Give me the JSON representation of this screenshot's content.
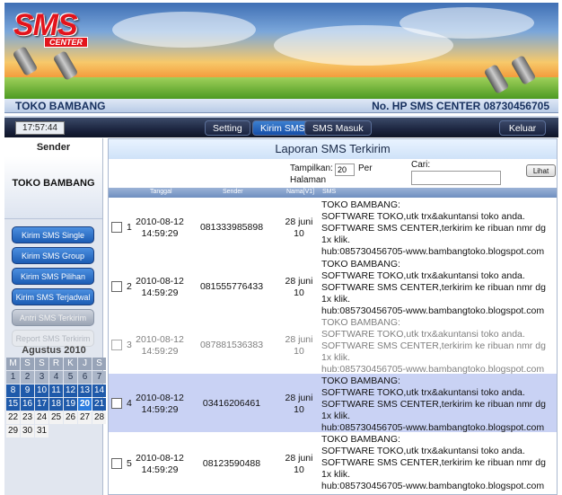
{
  "brand": {
    "logo_text": "SMS",
    "logo_sub": "CENTER"
  },
  "info_bar": {
    "shop_name": "TOKO BAMBANG",
    "hp_label": "No. HP SMS CENTER 08730456705"
  },
  "nav": {
    "clock": "17:57:44",
    "items": [
      "Setting",
      "Kirim SMS",
      "SMS Masuk",
      "Keluar"
    ],
    "active": "Kirim SMS"
  },
  "sidebar": {
    "header": "Sender",
    "shop_name": "TOKO BAMBANG",
    "menu": [
      "Kirim SMS Single",
      "Kirim SMS Group",
      "Kirim SMS Pilihan",
      "Kirim SMS Terjadwal",
      "Antri SMS Terkirim",
      "Report SMS Terkirim"
    ]
  },
  "calendar": {
    "month": "Agustus 2010",
    "weekdays": [
      "M",
      "S",
      "S",
      "R",
      "K",
      "J",
      "S"
    ],
    "prev_days": [
      1,
      2,
      3,
      4,
      5,
      6,
      7
    ],
    "days": [
      8,
      9,
      10,
      11,
      12,
      13,
      14,
      15,
      16,
      17,
      18,
      19,
      20,
      21,
      22,
      23,
      24,
      25,
      26,
      27,
      28,
      29,
      30,
      31
    ],
    "today": 20
  },
  "main": {
    "title": "Laporan SMS Terkirim",
    "show_label": "Tampilkan:",
    "show_value": "20",
    "per_label": "Per",
    "page_label": "Halaman",
    "search_label": "Cari:",
    "search_value": "",
    "view_button": "Lihat",
    "columns": [
      "Tanggal",
      "Sender",
      "Nama[V1]",
      "SMS"
    ],
    "rows": [
      {
        "no": "1",
        "date": "2010-08-12",
        "time": "14:59:29",
        "sender": "081333985898",
        "name": "28 juni",
        "name2": "10",
        "sms": "TOKO BAMBANG:\nSOFTWARE TOKO,utk trx&akuntansi toko anda.\nSOFTWARE SMS CENTER,terkirim ke ribuan nmr dg 1x klik.\nhub:085730456705-www.bambangtoko.blogspot.com"
      },
      {
        "no": "2",
        "date": "2010-08-12",
        "time": "14:59:29",
        "sender": "081555776433",
        "name": "28 juni",
        "name2": "10",
        "sms": "TOKO BAMBANG:\nSOFTWARE TOKO,utk trx&akuntansi toko anda.\nSOFTWARE SMS CENTER,terkirim ke ribuan nmr dg 1x klik.\nhub:085730456705-www.bambangtoko.blogspot.com"
      },
      {
        "no": "3",
        "date": "2010-08-12",
        "time": "14:59:29",
        "sender": "087881536383",
        "name": "28 juni",
        "name2": "10",
        "sms": "TOKO BAMBANG:\nSOFTWARE TOKO,utk trx&akuntansi toko anda.\nSOFTWARE SMS CENTER,terkirim ke ribuan nmr dg 1x klik.\nhub:085730456705-www.bambangtoko.blogspot.com"
      },
      {
        "no": "4",
        "date": "2010-08-12",
        "time": "14:59:29",
        "sender": "03416206461",
        "name": "28 juni",
        "name2": "10",
        "sms": "TOKO BAMBANG:\nSOFTWARE TOKO,utk trx&akuntansi toko anda.\nSOFTWARE SMS CENTER,terkirim ke ribuan nmr dg 1x klik.\nhub:085730456705-www.bambangtoko.blogspot.com"
      },
      {
        "no": "5",
        "date": "2010-08-12",
        "time": "14:59:29",
        "sender": "08123590488",
        "name": "28 juni",
        "name2": "10",
        "sms": "TOKO BAMBANG:\nSOFTWARE TOKO,utk trx&akuntansi toko anda.\nSOFTWARE SMS CENTER,terkirim ke ribuan nmr dg 1x klik.\nhub:085730456705-www.bambangtoko.blogspot.com"
      }
    ]
  }
}
